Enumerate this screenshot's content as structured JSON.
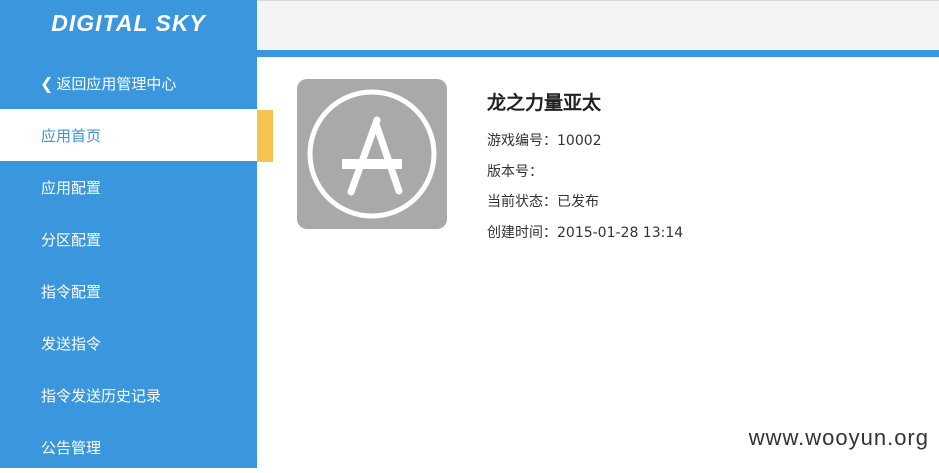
{
  "logo": {
    "text": "DIGITAL SKY"
  },
  "sidebar": {
    "back_label": "返回应用管理中心",
    "items": [
      {
        "label": "应用首页",
        "active": true
      },
      {
        "label": "应用配置"
      },
      {
        "label": "分区配置"
      },
      {
        "label": "指令配置"
      },
      {
        "label": "发送指令"
      },
      {
        "label": "指令发送历史记录"
      },
      {
        "label": "公告管理"
      }
    ]
  },
  "app": {
    "icon": "app-store-icon",
    "name": "龙之力量亚太",
    "game_id_label": "游戏编号：",
    "game_id": "10002",
    "version_label": "版本号：",
    "version": "",
    "status_label": "当前状态：",
    "status": "已发布",
    "created_label": "创建时间：",
    "created": "2015-01-28 13:14"
  },
  "watermark": "www.wooyun.org",
  "colors": {
    "primary": "#3a96dd",
    "accent": "#f6c44f",
    "icon_bg": "#a9a9a9"
  }
}
